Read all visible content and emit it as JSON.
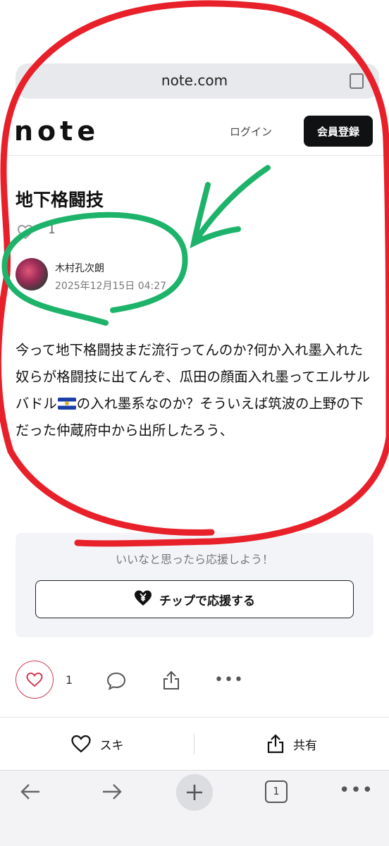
{
  "browser": {
    "url": "note.com",
    "open_tabs": "1",
    "more_glyph": "•••"
  },
  "header": {
    "logo": "note",
    "login": "ログイン",
    "signup": "会員登録"
  },
  "article": {
    "title": "地下格闘技",
    "like_count": "1",
    "author": "木村孔次朗",
    "date": "2025年12月15日 04:27",
    "body_1": "今って地下格闘技まだ流行ってんのか?何か入れ墨入れた奴らが格闘技に出てんぞ、瓜田の顔面入れ墨ってエルサルバドル",
    "body_2": "の入れ墨系なのか？そういえば筑波の上野の下だった仲蔵府中から出所したろう、"
  },
  "support": {
    "message": "いいなと思ったら応援しよう！",
    "tip_label": "チップで応援する"
  },
  "actions": {
    "like_count": "1",
    "more_glyph": "•••"
  },
  "bottom_bar": {
    "suki": "スキ",
    "share": "共有"
  },
  "colors": {
    "annotation_red": "#e8202a",
    "annotation_green": "#1db36a",
    "like_red": "#d23a55",
    "signup_bg": "#0f1113"
  }
}
